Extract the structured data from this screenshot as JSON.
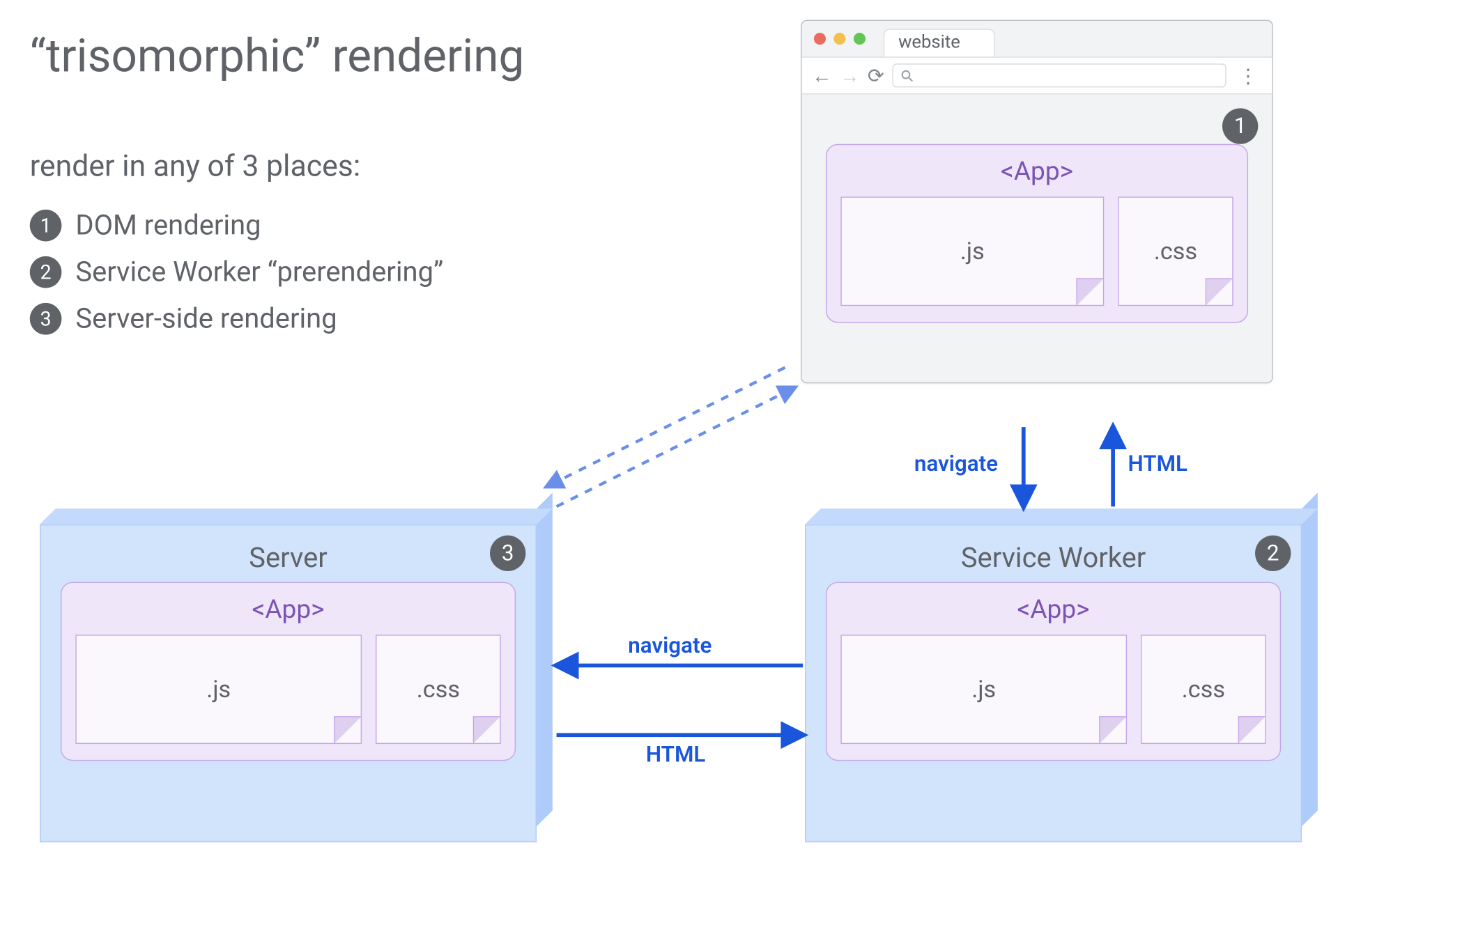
{
  "heading": "“trisomorphic” rendering",
  "subheading": "render in any of 3 places:",
  "items": [
    {
      "n": "1",
      "label": "DOM rendering"
    },
    {
      "n": "2",
      "label": "Service Worker “prerendering”"
    },
    {
      "n": "3",
      "label": "Server-side rendering"
    }
  ],
  "browser": {
    "tab_label": "website",
    "badge": "1",
    "app_label": "<App>",
    "files": {
      "js": ".js",
      "css": ".css"
    },
    "search_icon": "⚲"
  },
  "server": {
    "title": "Server",
    "badge": "3",
    "app_label": "<App>",
    "files": {
      "js": ".js",
      "css": ".css"
    }
  },
  "sw": {
    "title": "Service Worker",
    "badge": "2",
    "app_label": "<App>",
    "files": {
      "js": ".js",
      "css": ".css"
    }
  },
  "arrows": {
    "browser_sw_down": "navigate",
    "browser_sw_up": "HTML",
    "sw_server_left": "navigate",
    "sw_server_right": "HTML"
  }
}
